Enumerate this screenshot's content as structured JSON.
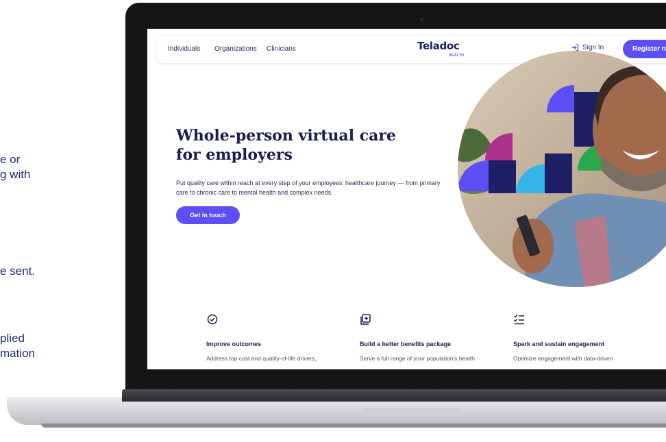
{
  "side_text": {
    "line1": "e or\ng with",
    "line2": "e sent.",
    "line3": "plied\nmation"
  },
  "nav": {
    "links": [
      "Individuals",
      "Organizations",
      "Clinicians"
    ],
    "logo": "Teladoc",
    "logo_sub": "HEALTH",
    "signin": "Sign In",
    "register": "Register now"
  },
  "hero": {
    "title": "Whole-person virtual care for employers",
    "subtitle": "Put quality care within reach at every step of your employees' healthcare journey — from primary care to chronic care to mental health and complex needs.",
    "cta": "Get in touch"
  },
  "features": [
    {
      "icon": "check-circle-icon",
      "title": "Improve outcomes",
      "text": "Address top cost and quality-of-life drivers,"
    },
    {
      "icon": "plus-document-icon",
      "title": "Build a better benefits package",
      "text": "Serve a full range of your population's health"
    },
    {
      "icon": "checklist-icon",
      "title": "Spark and sustain engagement",
      "text": "Optimize engagement with data-driven"
    }
  ],
  "colors": {
    "brand_purple": "#5b4ff5",
    "navy": "#1a1d4e",
    "side_text": "#1f2d6e"
  }
}
